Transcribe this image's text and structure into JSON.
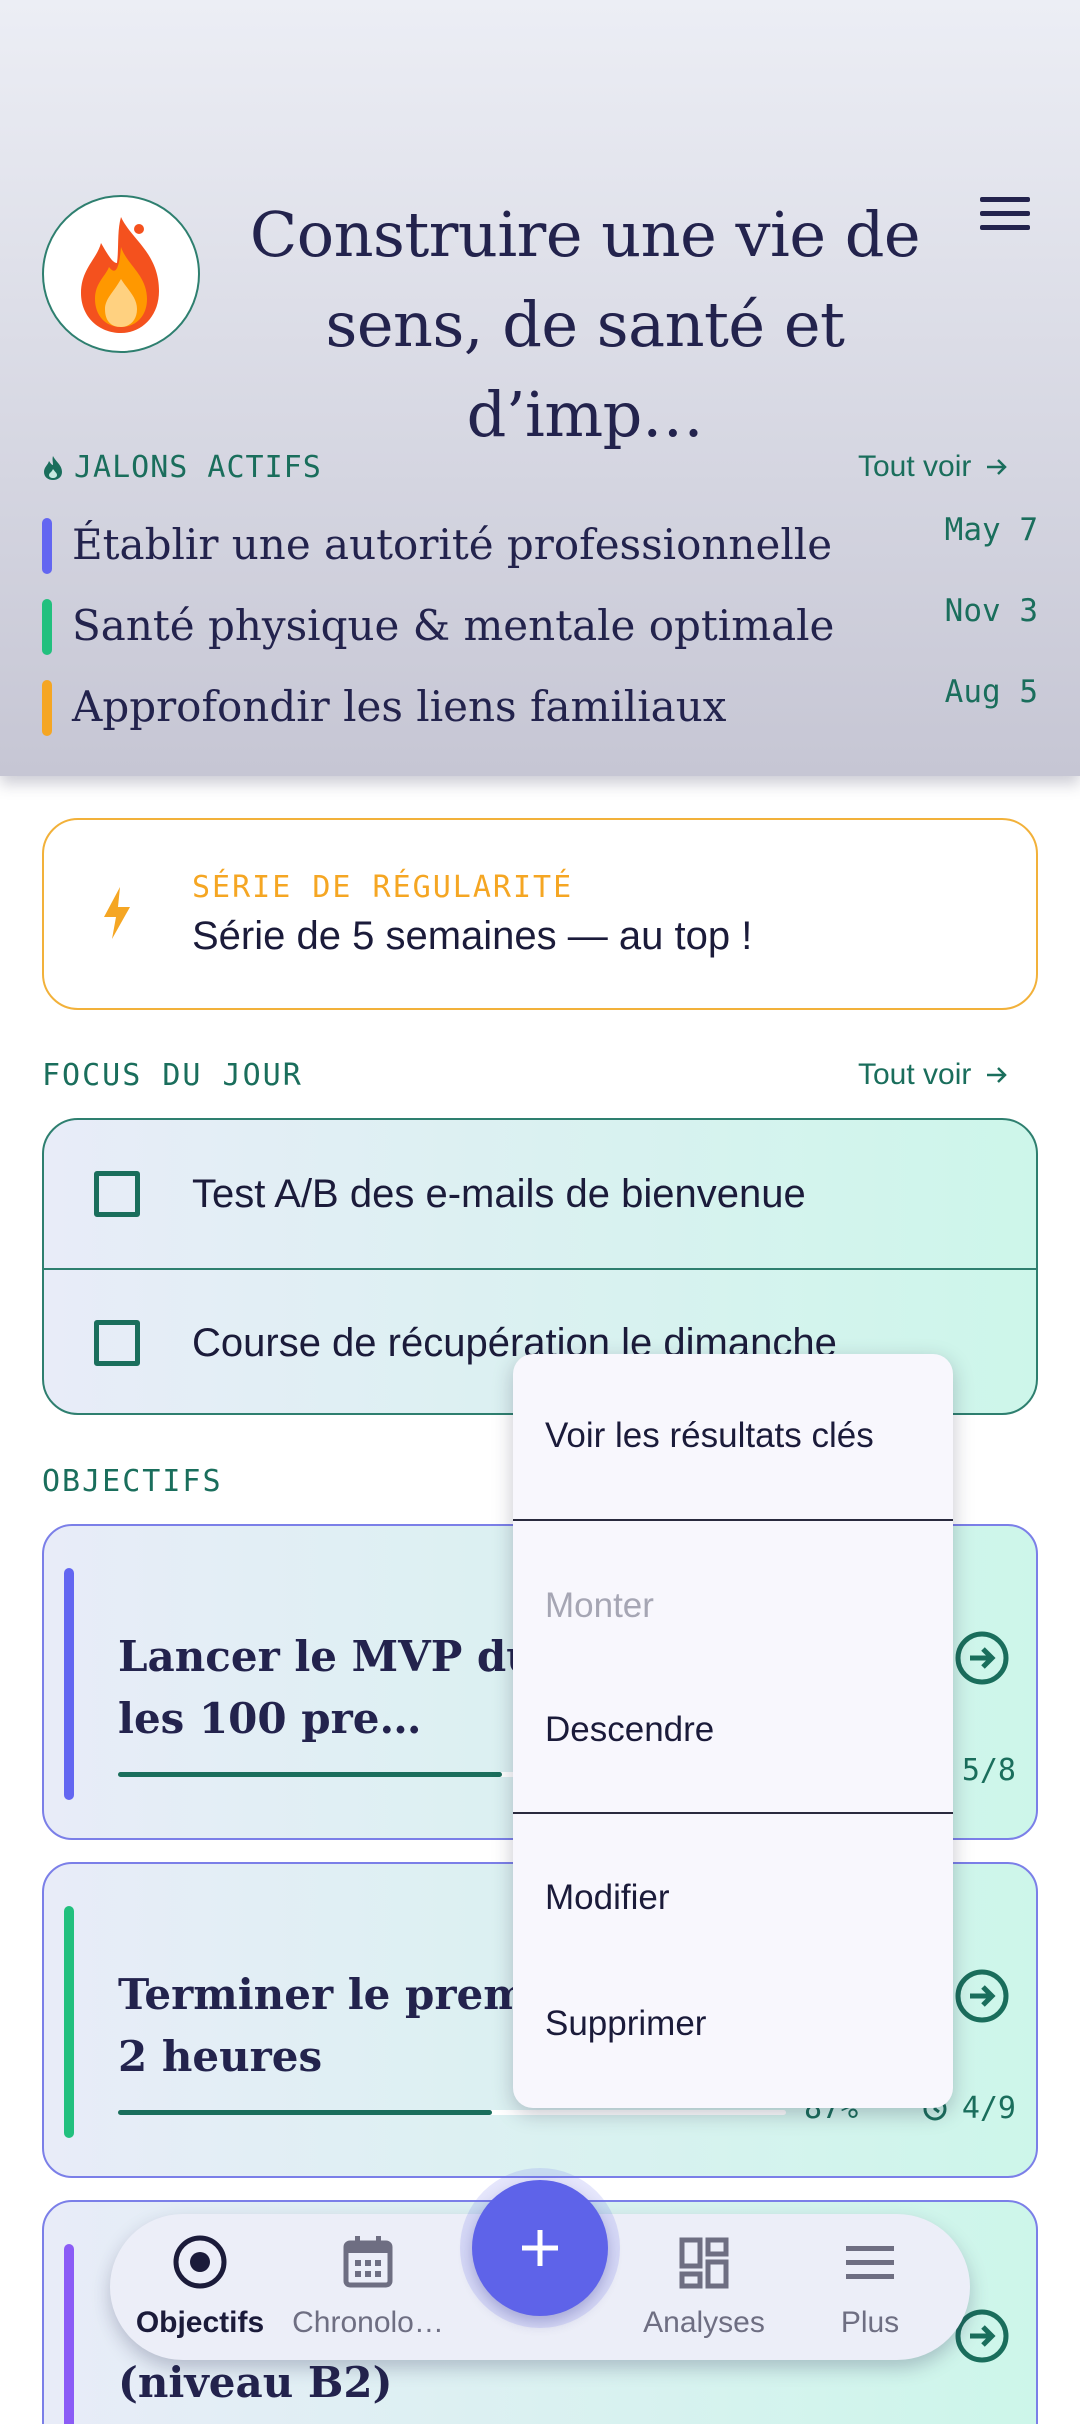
{
  "header": {
    "title": "Construire une vie de sens, de santé et d’imp…",
    "logo_icon": "flame-icon"
  },
  "milestones": {
    "section_label": "JALONS ACTIFS",
    "see_all": "Tout voir",
    "items": [
      {
        "label": "Établir une autorité professionnelle",
        "date": "May 7",
        "color": "#6366f1"
      },
      {
        "label": "Santé physique & mentale optimale",
        "date": "Nov 3",
        "color": "#22c07e"
      },
      {
        "label": "Approfondir les liens familiaux",
        "date": "Aug 5",
        "color": "#f5a623"
      }
    ]
  },
  "streak": {
    "label": "SÉRIE DE RÉGULARITÉ",
    "value": "Série de 5 semaines — au top !"
  },
  "focus": {
    "section_label": "FOCUS DU JOUR",
    "see_all": "Tout voir",
    "items": [
      {
        "label": "Test A/B des e-mails de bienvenue"
      },
      {
        "label": "Course de récupération le dimanche"
      }
    ]
  },
  "goals": {
    "section_label": "OBJECTIFS",
    "items": [
      {
        "title": "Lancer le MVP du produit et acquérir les 100 premiers",
        "title_visible": "Lancer le MVP du pr… acquérir les 100 pre…",
        "count": "5/8",
        "progress": 0.62,
        "color": "#6366f1"
      },
      {
        "title": "Terminer le premier … moins de 2 heures",
        "percent": "87%",
        "count": "4/9",
        "progress": 0.87,
        "color": "#22c07e"
      },
      {
        "title": "(niveau B2)",
        "color": "#8b5cf6"
      }
    ]
  },
  "context_menu": {
    "items": {
      "view_results": "Voir les résultats clés",
      "move_up": "Monter",
      "move_down": "Descendre",
      "edit": "Modifier",
      "delete": "Supprimer"
    }
  },
  "bottom_nav": {
    "tabs": [
      {
        "label": "Objectifs",
        "icon": "target-icon",
        "active": true
      },
      {
        "label": "Chronolo…",
        "icon": "calendar-icon"
      },
      {
        "label": "Analyses",
        "icon": "dashboard-icon"
      },
      {
        "label": "Plus",
        "icon": "menu-icon"
      }
    ],
    "fab_icon": "plus-icon"
  }
}
